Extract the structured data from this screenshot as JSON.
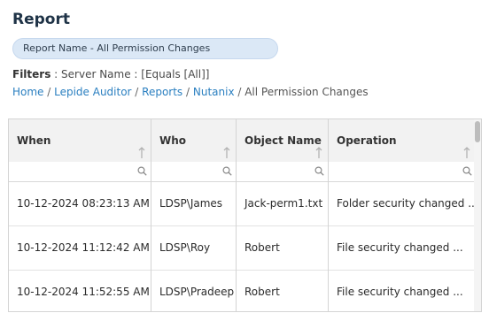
{
  "page": {
    "title": "Report",
    "report_pill": "Report Name - All Permission Changes",
    "filters_label": "Filters",
    "filters_value": " : Server Name : [Equals [All]]",
    "breadcrumb": [
      {
        "label": "Home",
        "link": true
      },
      {
        "label": "Lepide Auditor",
        "link": true
      },
      {
        "label": "Reports",
        "link": true
      },
      {
        "label": "Nutanix",
        "link": true
      },
      {
        "label": "All Permission Changes",
        "link": false
      }
    ],
    "breadcrumb_sep": " / "
  },
  "table": {
    "columns": [
      "When",
      "Who",
      "Object Name",
      "Operation"
    ],
    "rows": [
      [
        "10-12-2024 08:23:13 AM",
        "LDSP\\James",
        "Jack-perm1.txt",
        "Folder security changed ..."
      ],
      [
        "10-12-2024 11:12:42 AM",
        "LDSP\\Roy",
        "Robert",
        "File security changed ..."
      ],
      [
        "10-12-2024 11:52:55 AM",
        "LDSP\\Pradeep",
        "Robert",
        "File security changed ..."
      ]
    ]
  },
  "icons": {
    "sort": "sort-arrow-up-icon",
    "filter": "search-icon"
  },
  "colors": {
    "link": "#2a7fc0",
    "pill_bg": "#dbe8f6",
    "header_bg": "#f2f2f2"
  }
}
